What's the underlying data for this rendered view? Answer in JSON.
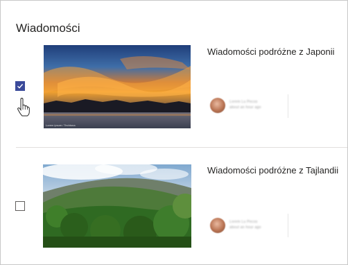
{
  "section": {
    "title": "Wiadomości"
  },
  "items": [
    {
      "title": "Wiadomości podróżne z Japonii",
      "checked": true,
      "author_name": "Lorem Lu Pecos",
      "author_meta": "about an hour ago",
      "image_caption": "Lorem ipsum / Techtona"
    },
    {
      "title": "Wiadomości podróżne z Tajlandii",
      "checked": false,
      "author_name": "Lorem Lu Pecos",
      "author_meta": "about an hour ago"
    }
  ],
  "colors": {
    "checkbox_checked": "#3b4a9a",
    "divider": "#e1dfdd"
  },
  "icons": {
    "checkmark": "checkmark-icon",
    "cursor": "hand-pointer-cursor-icon"
  }
}
